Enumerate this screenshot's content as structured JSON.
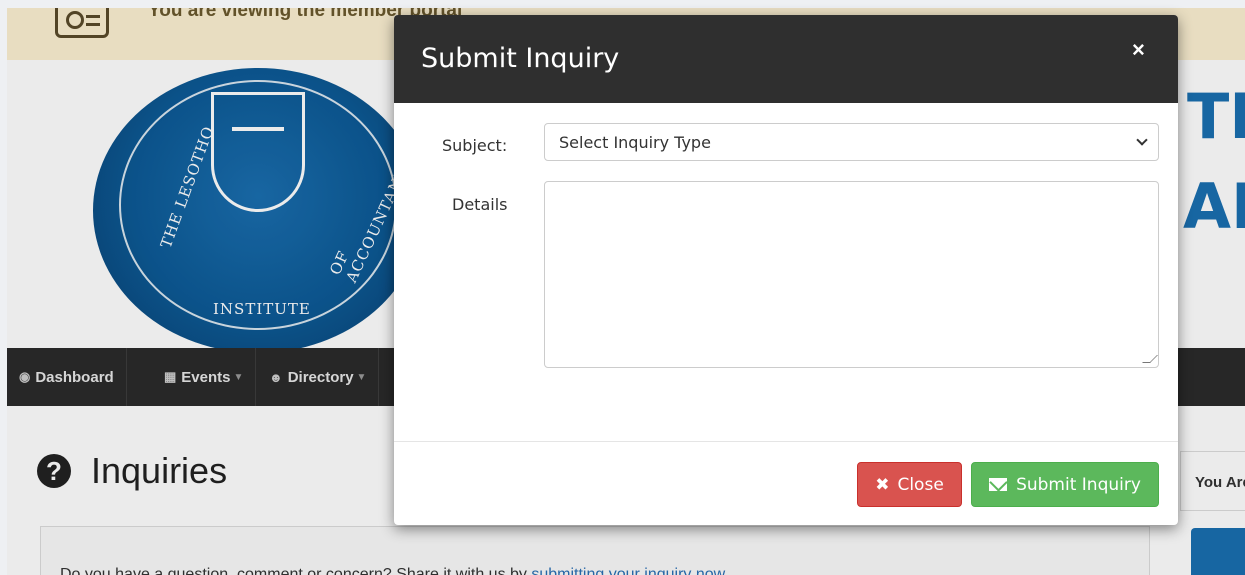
{
  "alert": {
    "text": "You are viewing the member portal"
  },
  "banner": {
    "seal_text_left": "THE LESOTHO",
    "seal_text_bottom": "INSTITUTE",
    "seal_text_right": "OF ACCOUNTANTS",
    "right_text_top": "TI",
    "right_text_bottom": "AI",
    "brand_color": "#1a6fb0"
  },
  "navbar": {
    "items": [
      {
        "label": "Dashboard",
        "icon": "dashboard-icon",
        "has_caret": false
      },
      {
        "label": "Events",
        "icon": "calendar-icon",
        "has_caret": true
      },
      {
        "label": "Directory",
        "icon": "users-icon",
        "has_caret": true
      }
    ]
  },
  "page": {
    "title": "Inquiries",
    "title_icon": "question-circle-icon",
    "intro_text": "Do you have a question, comment or concern? Share it with us by ",
    "intro_link": "submitting your inquiry now",
    "side_text": "You Are"
  },
  "modal": {
    "title": "Submit Inquiry",
    "close_symbol": "×",
    "subject_label": "Subject:",
    "subject_value": "Select Inquiry Type",
    "details_label": "Details",
    "details_value": "",
    "buttons": {
      "close_label": "Close",
      "submit_label": "Submit Inquiry"
    },
    "colors": {
      "header": "#2f2f2f",
      "close_button": "#d9534f",
      "submit_button": "#5cb85c"
    }
  }
}
